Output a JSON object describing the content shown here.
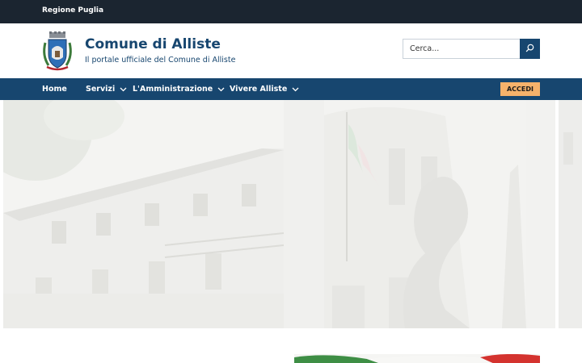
{
  "topbar": {
    "region_label": "Regione Puglia"
  },
  "header": {
    "title": "Comune di Alliste",
    "subtitle": "Il portale ufficiale del Comune di Alliste",
    "search_placeholder": "Cerca..."
  },
  "nav": {
    "items": [
      {
        "label": "Home",
        "dropdown": false
      },
      {
        "label": "Servizi",
        "dropdown": true
      },
      {
        "label": "L'Amministrazione",
        "dropdown": true
      },
      {
        "label": "Vivere Alliste",
        "dropdown": true
      }
    ],
    "login_label": "ACCEDI"
  },
  "colors": {
    "topbar": "#1b2530",
    "brand": "#17466f",
    "accent": "#f6b26b"
  },
  "icons": {
    "search": "search-icon",
    "chevron": "chevron-down-icon",
    "crest": "municipal-crest-icon"
  }
}
